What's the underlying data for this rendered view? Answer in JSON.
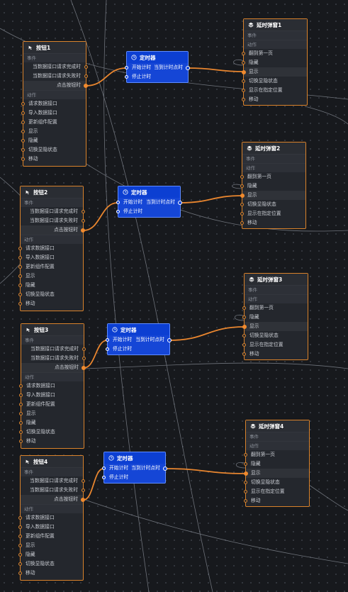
{
  "buttons": [
    {
      "title": "按钮1",
      "event_section": "事件",
      "events": [
        "当数据接口请求完成时",
        "当数据接口请求失败时",
        "点击按钮时"
      ],
      "action_section": "动作",
      "actions": [
        "请求数据接口",
        "导入数据接口",
        "更新组件配置",
        "显示",
        "隐藏",
        "切换显隐状态",
        "移动"
      ]
    },
    {
      "title": "按钮2",
      "event_section": "事件",
      "events": [
        "当数据接口请求完成时",
        "当数据接口请求失败时",
        "点击按钮时"
      ],
      "action_section": "动作",
      "actions": [
        "请求数据接口",
        "导入数据接口",
        "更新组件配置",
        "显示",
        "隐藏",
        "切换显隐状态",
        "移动"
      ]
    },
    {
      "title": "按钮3",
      "event_section": "事件",
      "events": [
        "当数据接口请求完成时",
        "当数据接口请求失败时",
        "点击按钮时"
      ],
      "action_section": "动作",
      "actions": [
        "请求数据接口",
        "导入数据接口",
        "更新组件配置",
        "显示",
        "隐藏",
        "切换显隐状态",
        "移动"
      ]
    },
    {
      "title": "按钮4",
      "event_section": "事件",
      "events": [
        "当数据接口请求完成时",
        "当数据接口请求失败时",
        "点击按钮时"
      ],
      "action_section": "动作",
      "actions": [
        "请求数据接口",
        "导入数据接口",
        "更新组件配置",
        "显示",
        "隐藏",
        "切换显隐状态",
        "移动"
      ]
    }
  ],
  "timers": [
    {
      "title": "定时器",
      "start": "开始计时",
      "tick": "当到计时点时",
      "stop": "停止计时"
    },
    {
      "title": "定时器",
      "start": "开始计时",
      "tick": "当到计时点时",
      "stop": "停止计时"
    },
    {
      "title": "定时器",
      "start": "开始计时",
      "tick": "当到计时点时",
      "stop": "停止计时"
    },
    {
      "title": "定时器",
      "start": "开始计时",
      "tick": "当到计时点时",
      "stop": "停止计时"
    }
  ],
  "popups": [
    {
      "title": "延时弹窗1",
      "event_section": "事件",
      "action_section": "动作",
      "actions": [
        "翻到第一页",
        "隐藏",
        "显示",
        "切换显隐状态",
        "显示在指定位置",
        "移动"
      ]
    },
    {
      "title": "延时弹窗2",
      "event_section": "事件",
      "action_section": "动作",
      "actions": [
        "翻到第一页",
        "隐藏",
        "显示",
        "切换显隐状态",
        "显示在指定位置",
        "移动"
      ]
    },
    {
      "title": "延时弹窗3",
      "event_section": "事件",
      "action_section": "动作",
      "actions": [
        "翻到第一页",
        "隐藏",
        "显示",
        "切换显隐状态",
        "显示在指定位置",
        "移动"
      ]
    },
    {
      "title": "延时弹窗4",
      "event_section": "事件",
      "action_section": "动作",
      "actions": [
        "翻到第一页",
        "隐藏",
        "显示",
        "切换显隐状态",
        "显示在指定位置",
        "移动"
      ]
    }
  ],
  "colors": {
    "wire": "#e9862f",
    "node_border": "#d9822b",
    "timer_bg": "#1546d6",
    "canvas_bg": "#17191d"
  },
  "icons": {
    "button": "button-icon",
    "timer": "clock-icon",
    "popup": "layers-icon"
  }
}
